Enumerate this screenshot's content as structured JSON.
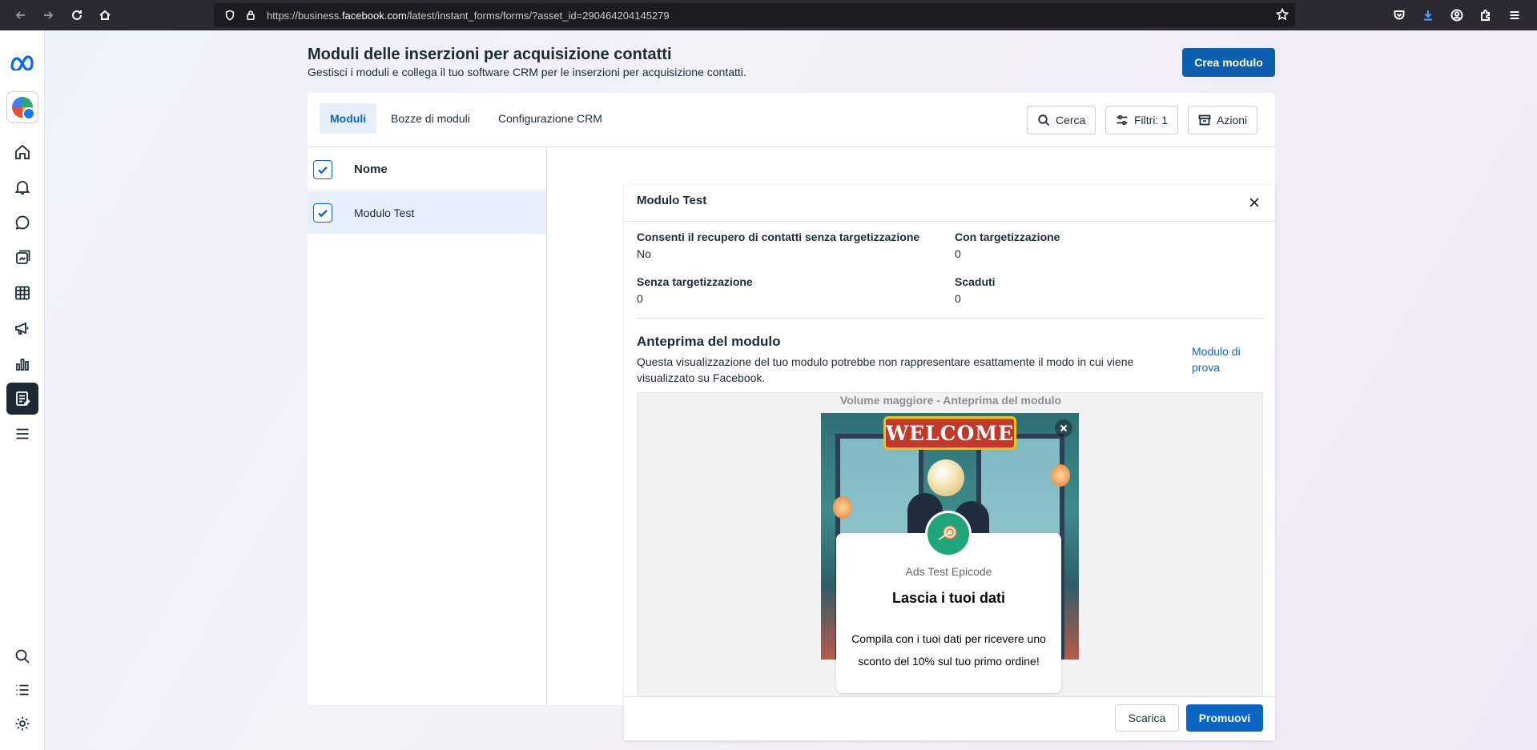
{
  "browser": {
    "url_prefix": "https://business.",
    "url_domain": "facebook.com",
    "url_path": "/latest/instant_forms/forms/?asset_id=290464204145279"
  },
  "header": {
    "title": "Moduli delle inserzioni per acquisizione contatti",
    "subtitle": "Gestisci i moduli e collega il tuo software CRM per le inserzioni per acquisizione contatti.",
    "create_button": "Crea modulo"
  },
  "tabs": [
    {
      "label": "Moduli",
      "active": true
    },
    {
      "label": "Bozze di moduli",
      "active": false
    },
    {
      "label": "Configurazione CRM",
      "active": false
    }
  ],
  "toolbar": {
    "search": "Cerca",
    "filters": "Filtri: 1",
    "actions": "Azioni"
  },
  "list": {
    "column_title": "Nome",
    "rows": [
      {
        "name": "Modulo Test",
        "checked": true
      }
    ]
  },
  "detail": {
    "title": "Modulo Test",
    "fields": [
      {
        "label": "Consenti il recupero di contatti senza targetizzazione",
        "value": "No"
      },
      {
        "label": "Con targetizzazione",
        "value": "0"
      },
      {
        "label": "Senza targetizzazione",
        "value": "0"
      },
      {
        "label": "Scaduti",
        "value": "0"
      }
    ],
    "preview_title": "Anteprima del modulo",
    "preview_description": "Questa visualizzazione del tuo modulo potrebbe non rappresentare esattamente il modo in cui viene visualizzato su Facebook.",
    "test_link": "Modulo di prova",
    "preview_caption": "Volume maggiore - Anteprima del modulo",
    "welcome_banner": "WELCOME",
    "brand_name": "Ads Test Epicode",
    "lead_title": "Lascia i tuoi dati",
    "lead_text": "Compila con i tuoi dati per ricevere uno sconto del 10% sul tuo primo ordine!",
    "download_button": "Scarica",
    "promote_button": "Promuovi"
  },
  "colors": {
    "primary": "#0a66c2",
    "rail_active": "#1c2b33",
    "tab_active_bg": "#e7f0fa"
  },
  "rail_icons": [
    "meta-logo-icon",
    "account-avatar",
    "home-icon",
    "notifications-icon",
    "messages-icon",
    "content-icon",
    "planner-icon",
    "ads-icon",
    "insights-icon",
    "lead-forms-icon",
    "all-tools-icon",
    "search-icon",
    "list-icon",
    "settings-icon",
    "help-icon"
  ]
}
